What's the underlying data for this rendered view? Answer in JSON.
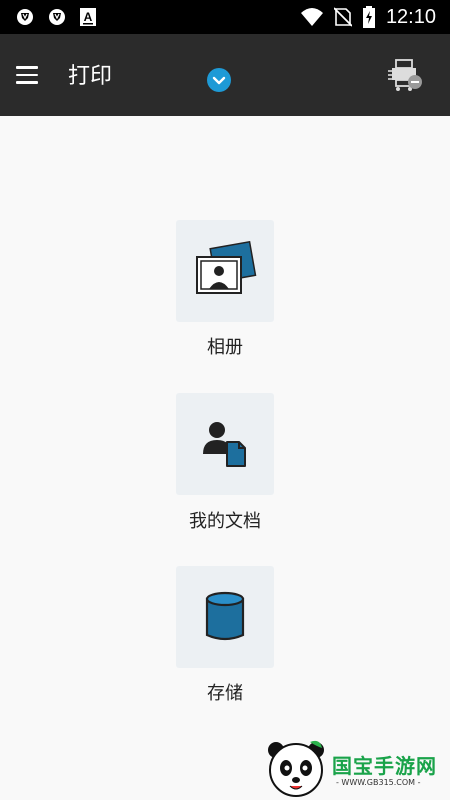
{
  "status_bar": {
    "time": "12:10",
    "icons": [
      "shield-notification-icon",
      "shield-notification-icon",
      "font-a-icon",
      "wifi-icon",
      "no-sim-icon",
      "battery-charging-icon"
    ]
  },
  "app_bar": {
    "title": "打印",
    "menu_icon": "hamburger-menu-icon",
    "dropdown_icon": "chevron-down-icon",
    "printer_icon": "printer-status-icon",
    "background": "#2b2b2b",
    "accent": "#1e9ad6"
  },
  "tiles": [
    {
      "label": "相册",
      "icon": "photos-icon"
    },
    {
      "label": "我的文档",
      "icon": "my-documents-icon"
    },
    {
      "label": "存储",
      "icon": "storage-icon"
    }
  ],
  "watermark": {
    "text": "国宝手游网",
    "sub": "- WWW.GB315.COM -"
  }
}
